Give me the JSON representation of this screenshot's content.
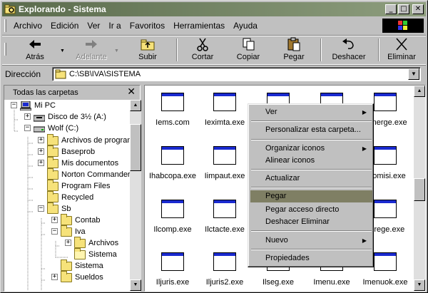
{
  "window": {
    "title": "Explorando - Sistema"
  },
  "title_buttons": {
    "minimize": "_",
    "maximize": "□",
    "close": "✕"
  },
  "menu": [
    "Archivo",
    "Edición",
    "Ver",
    "Ir a",
    "Favoritos",
    "Herramientas",
    "Ayuda"
  ],
  "toolbar": {
    "back": "Atrás",
    "forward": "Adelante",
    "up": "Subir",
    "cut": "Cortar",
    "copy": "Copiar",
    "paste": "Pegar",
    "undo": "Deshacer",
    "delete": "Eliminar"
  },
  "address": {
    "label": "Dirección",
    "value": "C:\\SB\\IVA\\SISTEMA"
  },
  "folders_pane": {
    "title": "Todas las carpetas",
    "close": "✕"
  },
  "tree": [
    {
      "label": "Mi PC",
      "icon": "computer-icon"
    },
    {
      "label": "Disco de 3½ (A:)",
      "icon": "floppy-icon"
    },
    {
      "label": "Wolf (C:)",
      "icon": "drive-icon"
    },
    {
      "label": "Archivos de program",
      "icon": "folder-icon"
    },
    {
      "label": "Baseprob",
      "icon": "folder-icon"
    },
    {
      "label": "Mis documentos",
      "icon": "folder-icon"
    },
    {
      "label": "Norton Commander",
      "icon": "folder-icon"
    },
    {
      "label": "Program Files",
      "icon": "folder-icon"
    },
    {
      "label": "Recycled",
      "icon": "folder-icon"
    },
    {
      "label": "Sb",
      "icon": "folder-icon"
    },
    {
      "label": "Contab",
      "icon": "folder-icon"
    },
    {
      "label": "Iva",
      "icon": "folder-icon"
    },
    {
      "label": "Archivos",
      "icon": "folder-icon"
    },
    {
      "label": "Sistema",
      "icon": "folder-open-icon"
    },
    {
      "label": "Sistema",
      "icon": "folder-icon"
    },
    {
      "label": "Sueldos",
      "icon": "folder-icon"
    }
  ],
  "files": [
    "Iems.com",
    "Ieximta.exe",
    "",
    "",
    "Iemerge.exe",
    "Ihabcopa.exe",
    "Iimpaut.exe",
    "",
    "",
    "Ilcomisi.exe",
    "Ilcomp.exe",
    "Ilctacte.exe",
    "",
    "",
    "Ilgrege.exe",
    "Iljuris.exe",
    "Iljuris2.exe",
    "Ilseg.exe",
    "Imenu.exe",
    "Imenuok.exe"
  ],
  "context_menu": {
    "ver": "Ver",
    "personalizar": "Personalizar esta carpeta...",
    "organizar": "Organizar iconos",
    "alinear": "Alinear iconos",
    "actualizar": "Actualizar",
    "pegar": "Pegar",
    "pegar_acceso": "Pegar acceso directo",
    "deshacer": "Deshacer Eliminar",
    "nuevo": "Nuevo",
    "propiedades": "Propiedades"
  },
  "colors": {
    "titlebar": "#5a6b4c",
    "menu_highlight": "#7f7f64",
    "icon_bar": "#1a2ad0",
    "folder": "#f6e27a"
  }
}
